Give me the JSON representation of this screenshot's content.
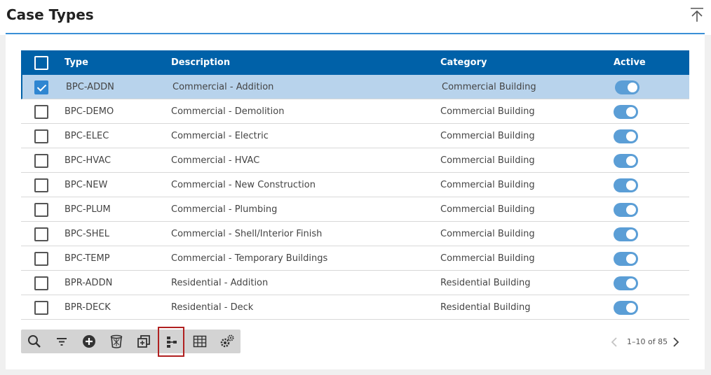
{
  "page": {
    "title": "Case Types"
  },
  "grid": {
    "columns": {
      "type": "Type",
      "description": "Description",
      "category": "Category",
      "active": "Active"
    },
    "rows": [
      {
        "type": "BPC-ADDN",
        "description": "Commercial - Addition",
        "category": "Commercial Building",
        "selected": true,
        "active": true
      },
      {
        "type": "BPC-DEMO",
        "description": "Commercial - Demolition",
        "category": "Commercial Building",
        "selected": false,
        "active": true
      },
      {
        "type": "BPC-ELEC",
        "description": "Commercial - Electric",
        "category": "Commercial Building",
        "selected": false,
        "active": true
      },
      {
        "type": "BPC-HVAC",
        "description": "Commercial - HVAC",
        "category": "Commercial Building",
        "selected": false,
        "active": true
      },
      {
        "type": "BPC-NEW",
        "description": "Commercial - New Construction",
        "category": "Commercial Building",
        "selected": false,
        "active": true
      },
      {
        "type": "BPC-PLUM",
        "description": "Commercial - Plumbing",
        "category": "Commercial Building",
        "selected": false,
        "active": true
      },
      {
        "type": "BPC-SHEL",
        "description": "Commercial - Shell/Interior Finish",
        "category": "Commercial Building",
        "selected": false,
        "active": true
      },
      {
        "type": "BPC-TEMP",
        "description": "Commercial - Temporary Buildings",
        "category": "Commercial Building",
        "selected": false,
        "active": true
      },
      {
        "type": "BPR-ADDN",
        "description": "Residential - Addition",
        "category": "Residential Building",
        "selected": false,
        "active": true
      },
      {
        "type": "BPR-DECK",
        "description": "Residential - Deck",
        "category": "Residential Building",
        "selected": false,
        "active": true
      }
    ]
  },
  "toolbar": {
    "tools": [
      "search-icon",
      "filter-icon",
      "add-icon",
      "delete-icon",
      "copy-icon",
      "hierarchy-icon",
      "table-icon",
      "settings-icon"
    ],
    "active_tool": "hierarchy-icon"
  },
  "pager": {
    "info": "1–10 of 85"
  },
  "colors": {
    "header": "#0061a8",
    "accent": "#3a8fd6",
    "selected_row": "#b8d3ec",
    "toggle": "#5b9ed6",
    "highlight_border": "#b02020"
  }
}
